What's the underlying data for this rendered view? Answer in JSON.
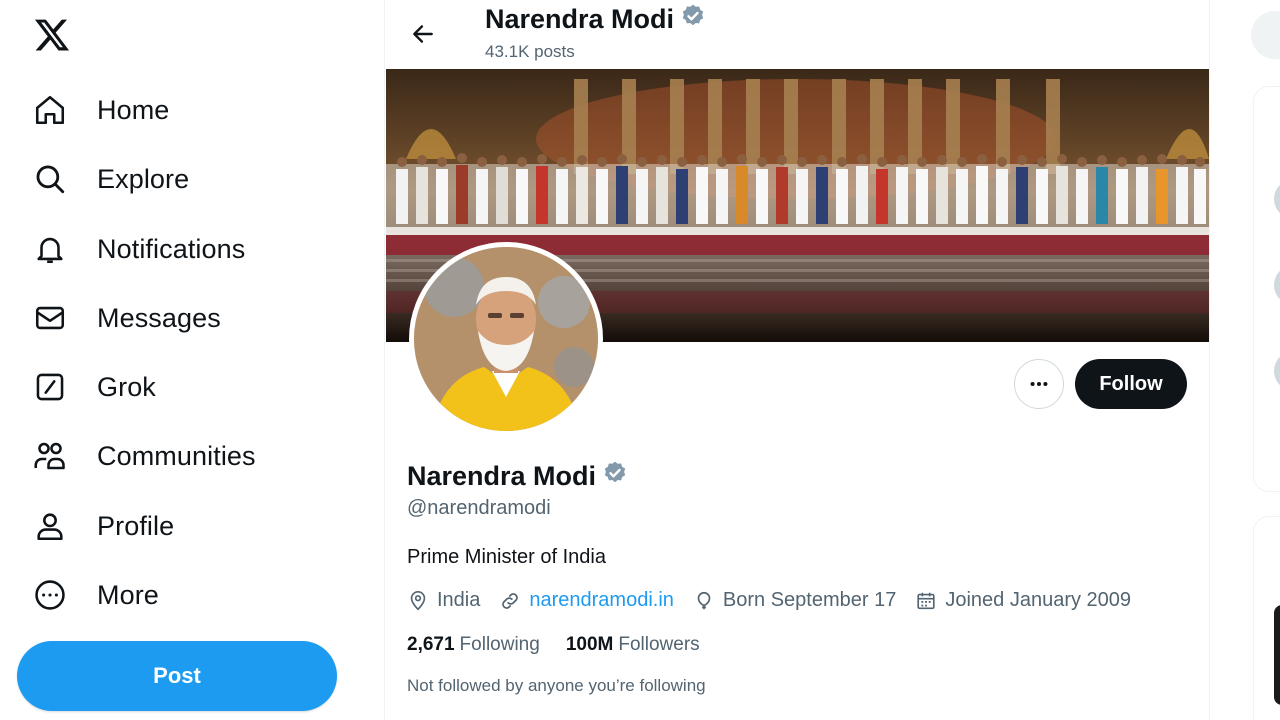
{
  "sidebar": {
    "logo": "x-logo-icon",
    "items": [
      {
        "label": "Home",
        "icon": "home-icon"
      },
      {
        "label": "Explore",
        "icon": "search-icon"
      },
      {
        "label": "Notifications",
        "icon": "bell-icon"
      },
      {
        "label": "Messages",
        "icon": "envelope-icon"
      },
      {
        "label": "Grok",
        "icon": "grok-icon"
      },
      {
        "label": "Communities",
        "icon": "communities-icon"
      },
      {
        "label": "Profile",
        "icon": "person-icon"
      },
      {
        "label": "More",
        "icon": "more-circle-icon"
      }
    ],
    "post_label": "Post"
  },
  "header": {
    "name": "Narendra Modi",
    "posts": "43.1K posts"
  },
  "profile": {
    "name": "Narendra Modi",
    "handle": "@narendramodi",
    "bio": "Prime Minister of India",
    "location": "India",
    "website": "narendramodi.in",
    "born": "Born September 17",
    "joined": "Joined January 2009",
    "following_count": "2,671",
    "following_label": "Following",
    "followers_count": "100M",
    "followers_label": "Followers",
    "not_followed": "Not followed by anyone you’re following",
    "follow_label": "Follow"
  },
  "colors": {
    "accent": "#1d9bf0",
    "text": "#0f1419",
    "muted": "#536471",
    "verified": "#829aab"
  }
}
